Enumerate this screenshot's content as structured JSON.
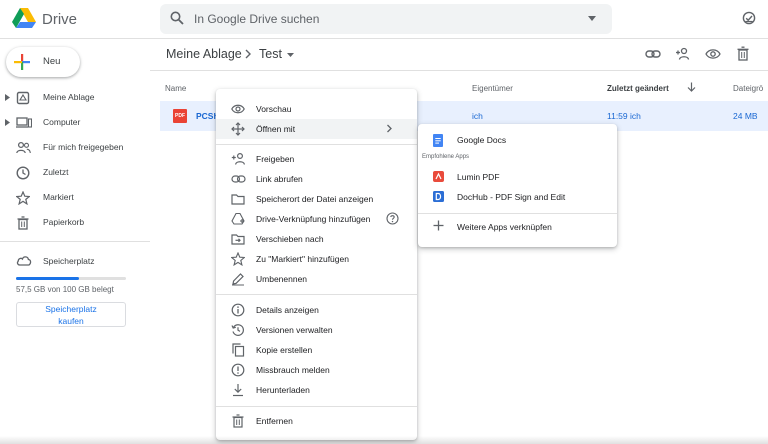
{
  "app": {
    "name": "Drive"
  },
  "search": {
    "placeholder": "In Google Drive suchen"
  },
  "sidebar": {
    "new_label": "Neu",
    "items": [
      {
        "label": "Meine Ablage",
        "icon": "my-drive-icon"
      },
      {
        "label": "Computer",
        "icon": "computer-icon"
      },
      {
        "label": "Für mich freigegeben",
        "icon": "shared-icon"
      },
      {
        "label": "Zuletzt",
        "icon": "recent-icon"
      },
      {
        "label": "Markiert",
        "icon": "star-icon"
      },
      {
        "label": "Papierkorb",
        "icon": "trash-icon"
      }
    ],
    "storage": {
      "title": "Speicherplatz",
      "used_text": "57,5 GB von 100 GB belegt",
      "used_fraction": 0.575,
      "buy_line1": "Speicherplatz",
      "buy_line2": "kaufen"
    }
  },
  "breadcrumb": {
    "root": "Meine Ablage",
    "current": "Test"
  },
  "table": {
    "columns": {
      "name": "Name",
      "owner": "Eigentümer",
      "modified": "Zuletzt geändert",
      "size": "Dateigrö"
    },
    "row": {
      "name": "PCSh",
      "owner": "ich",
      "modified": "11:59  ich",
      "size": "24 MB",
      "type_badge": "PDF"
    }
  },
  "context_menu": {
    "items": [
      {
        "label": "Vorschau",
        "icon": "eye-icon"
      },
      {
        "label": "Öffnen mit",
        "icon": "open-with-icon"
      },
      {
        "label": "Freigeben",
        "icon": "share-icon"
      },
      {
        "label": "Link abrufen",
        "icon": "link-icon"
      },
      {
        "label": "Speicherort der Datei anzeigen",
        "icon": "folder-icon"
      },
      {
        "label": "Drive-Verknüpfung hinzufügen",
        "icon": "shortcut-icon"
      },
      {
        "label": "Verschieben nach",
        "icon": "move-icon"
      },
      {
        "label": "Zu \"Markiert\" hinzufügen",
        "icon": "star-icon"
      },
      {
        "label": "Umbenennen",
        "icon": "rename-icon"
      },
      {
        "label": "Details anzeigen",
        "icon": "info-icon"
      },
      {
        "label": "Versionen verwalten",
        "icon": "history-icon"
      },
      {
        "label": "Kopie erstellen",
        "icon": "copy-icon"
      },
      {
        "label": "Missbrauch melden",
        "icon": "report-icon"
      },
      {
        "label": "Herunterladen",
        "icon": "download-icon"
      },
      {
        "label": "Entfernen",
        "icon": "trash-icon"
      }
    ]
  },
  "submenu": {
    "google_docs": "Google Docs",
    "recommended_header": "Empfohlene Apps",
    "apps": [
      {
        "label": "Lumin PDF",
        "icon": "lumin-icon",
        "color": "#e94b3c"
      },
      {
        "label": "DocHub - PDF Sign and Edit",
        "icon": "dochub-icon",
        "color": "#2c6ed5"
      }
    ],
    "connect_more": "Weitere Apps verknüpfen"
  },
  "colors": {
    "accent": "#1a73e8",
    "selected_row": "#e8f0fe",
    "docs_blue": "#4285f4"
  }
}
